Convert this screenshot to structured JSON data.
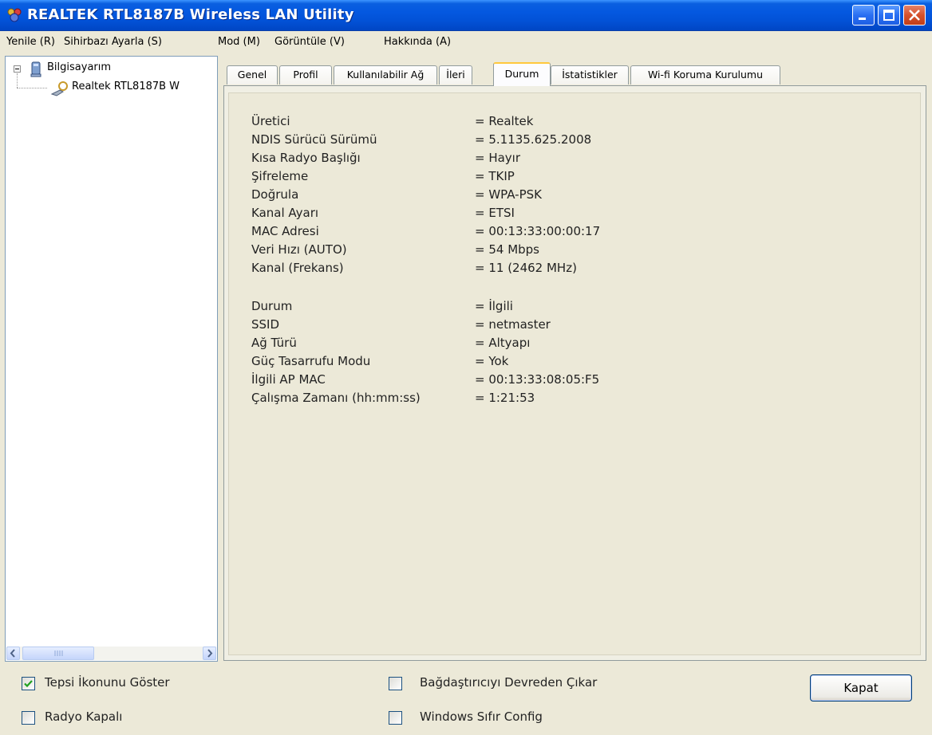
{
  "window": {
    "title": "REALTEK RTL8187B Wireless LAN Utility",
    "controls": [
      "minimize-icon",
      "maximize-icon",
      "close-icon"
    ],
    "accent": "#0458e0"
  },
  "menu": [
    "Yenile (R)",
    "Sihirbazı Ayarla (S)",
    "Mod (M)",
    "Görüntüle (V)",
    "Hakkında (A)"
  ],
  "tree": {
    "root": "Bilgisayarım",
    "child": "Realtek RTL8187B W"
  },
  "tabs": [
    {
      "label": "Genel"
    },
    {
      "label": "Profil"
    },
    {
      "label": "Kullanılabilir Ağ"
    },
    {
      "label": "İleri"
    },
    {
      "label": "Durum"
    },
    {
      "label": "İstatistikler"
    },
    {
      "label": "Wi-fi Koruma Kurulumu"
    }
  ],
  "active_tab": "Durum",
  "status": {
    "group1": [
      {
        "label": "Üretici",
        "value": "= Realtek"
      },
      {
        "label": "NDIS Sürücü Sürümü",
        "value": "= 5.1135.625.2008"
      },
      {
        "label": "Kısa Radyo Başlığı",
        "value": "= Hayır"
      },
      {
        "label": "Şifreleme",
        "value": "= TKIP"
      },
      {
        "label": "Doğrula",
        "value": "= WPA-PSK"
      },
      {
        "label": "Kanal Ayarı",
        "value": "= ETSI"
      },
      {
        "label": "MAC Adresi",
        "value": "= 00:13:33:00:00:17"
      },
      {
        "label": "Veri Hızı (AUTO)",
        "value": "= 54 Mbps"
      },
      {
        "label": "Kanal (Frekans)",
        "value": "= 11 (2462 MHz)"
      }
    ],
    "group2": [
      {
        "label": "Durum",
        "value": "= İlgili"
      },
      {
        "label": "SSID",
        "value": "= netmaster"
      },
      {
        "label": "Ağ Türü",
        "value": "= Altyapı"
      },
      {
        "label": "Güç Tasarrufu Modu",
        "value": "= Yok"
      },
      {
        "label": "İlgili AP MAC",
        "value": "= 00:13:33:08:05:F5"
      },
      {
        "label": "Çalışma Zamanı (hh:mm:ss)",
        "value": "= 1:21:53"
      }
    ]
  },
  "options": {
    "show_tray_icon": {
      "label": "Tepsi İkonunu Göster",
      "checked": true
    },
    "radio_off": {
      "label": "Radyo Kapalı",
      "checked": false
    },
    "disable_adapter": {
      "label": "Bağdaştırıcıyı Devreden Çıkar",
      "checked": false
    },
    "windows_zero_config": {
      "label": "Windows Sıfır Config",
      "checked": false
    }
  },
  "close_button": "Kapat"
}
